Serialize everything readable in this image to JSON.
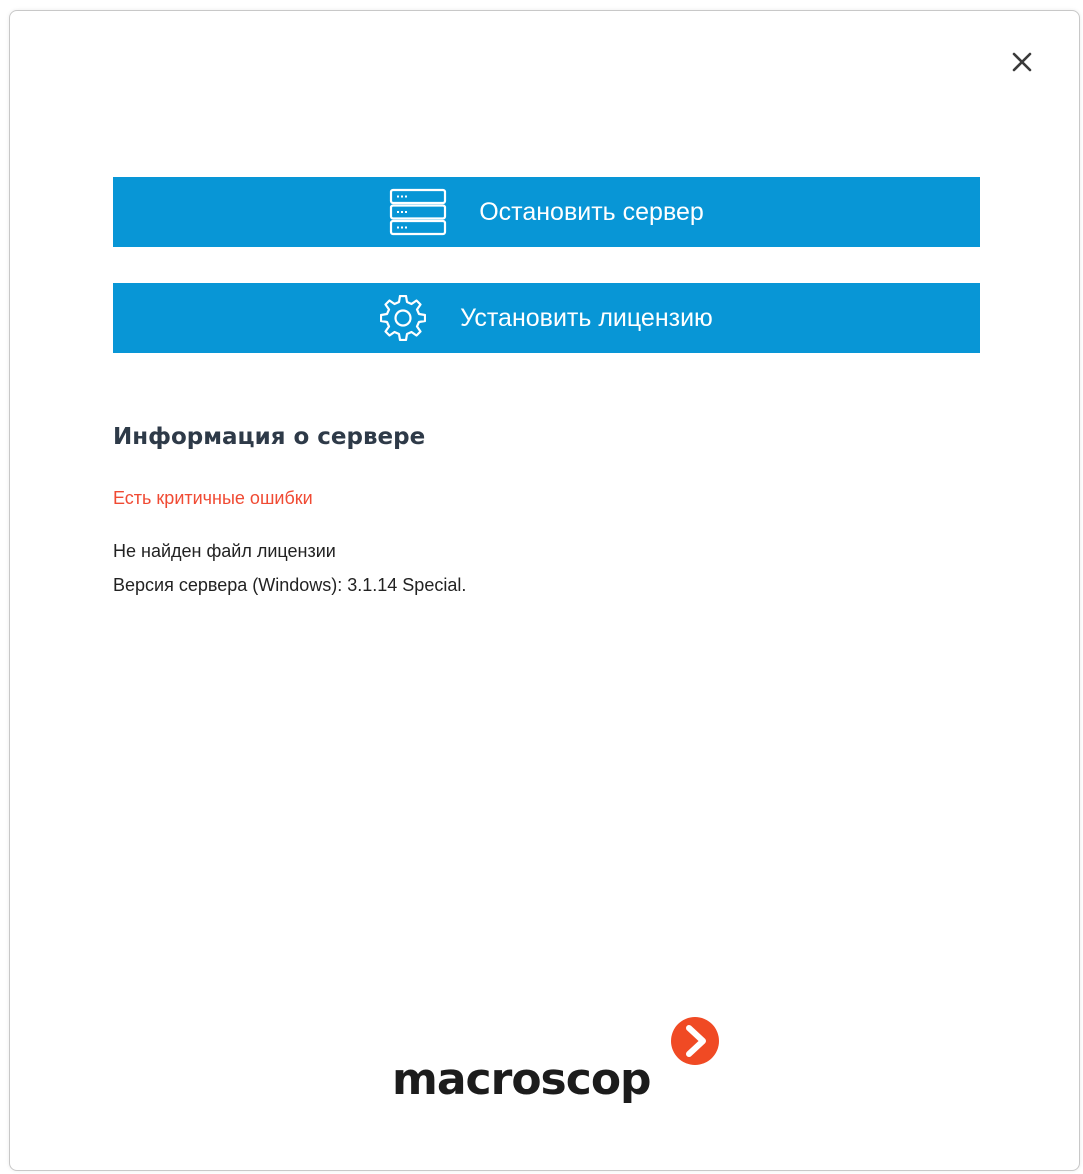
{
  "dialog": {
    "close_symbol": "✕"
  },
  "actions": {
    "stop_server": {
      "label": "Остановить сервер",
      "icon": "server-icon"
    },
    "install_license": {
      "label": "Установить лицензию",
      "icon": "gear-icon"
    }
  },
  "server_info": {
    "title": "Информация о сервере",
    "status": "Есть критичные ошибки",
    "lines": [
      "Не найден файл лицензии",
      "Версия сервера (Windows): 3.1.14 Special."
    ]
  },
  "brand": {
    "name": "macroscop",
    "accent_color": "#f04a24"
  },
  "colors": {
    "button": "#0896d6",
    "error": "#f04a33",
    "title": "#2e3a48"
  }
}
